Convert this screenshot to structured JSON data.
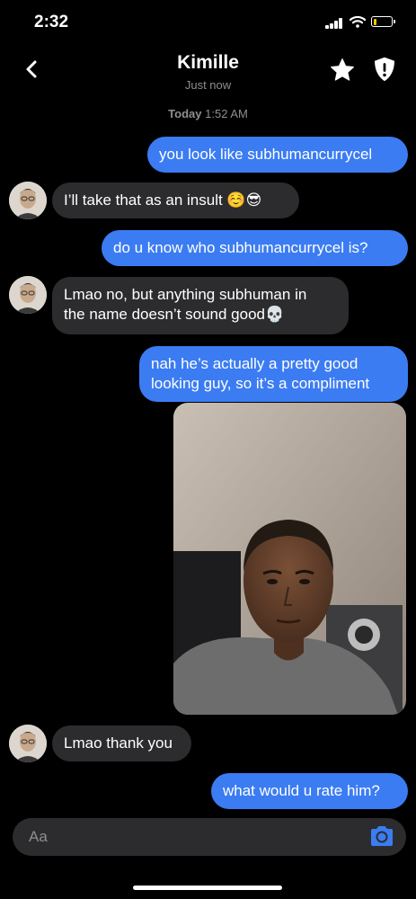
{
  "status_bar": {
    "time": "2:32"
  },
  "header": {
    "title": "Kimille",
    "subtitle": "Just now"
  },
  "timestamp": {
    "day": "Today",
    "time": "1:52 AM"
  },
  "messages": [
    {
      "side": "out",
      "text": "you look like subhumancurrycel"
    },
    {
      "side": "in",
      "text": "I’ll take that as an insult ☺️😎"
    },
    {
      "side": "out",
      "text": "do u know who subhumancurrycel is?"
    },
    {
      "side": "in",
      "line1": "Lmao no, but anything subhuman in",
      "line2": "the name doesn’t sound good💀"
    },
    {
      "side": "out",
      "line1": "nah he’s actually a pretty good",
      "line2": "looking guy, so it’s a compliment"
    },
    {
      "side": "in",
      "text": "Lmao thank you"
    },
    {
      "side": "out",
      "text": "what would u rate him?"
    }
  ],
  "composer": {
    "placeholder": "Aa"
  },
  "icons": {
    "back": "chevron-left-icon",
    "star": "star-icon",
    "shield": "shield-icon",
    "camera": "camera-icon",
    "signal": "signal-icon",
    "wifi": "wifi-icon",
    "battery": "battery-icon"
  },
  "colors": {
    "outgoing_bubble": "#3b7cf2",
    "incoming_bubble": "#2c2c2e",
    "background": "#000000",
    "battery_level": "#f5c400"
  }
}
